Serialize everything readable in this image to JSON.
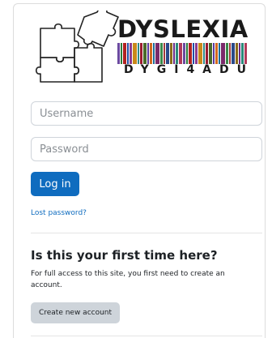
{
  "logo": {
    "title": "DYSLEXIA",
    "subtitle": "DYGI4ADU",
    "barcode_colors": [
      "#6b4aa0",
      "#2a7a3a",
      "#b22222",
      "#1f4fa8",
      "#8e3b8e",
      "#c98a1a",
      "#2e8b8b",
      "#9b1b30",
      "#4a6a2a",
      "#5a3aa0",
      "#d2691e",
      "#1b6e9b",
      "#7a2a6a",
      "#3a8a4a",
      "#a03a3a",
      "#2a4a8a",
      "#8a6a1a",
      "#6a2a8a",
      "#2a8a7a",
      "#b03a5a"
    ]
  },
  "login": {
    "username_placeholder": "Username",
    "password_placeholder": "Password",
    "login_label": "Log in",
    "lost_password": "Lost password?"
  },
  "signup": {
    "heading": "Is this your first time here?",
    "description": "For full access to this site, you first need to create an account.",
    "create_label": "Create new account"
  }
}
